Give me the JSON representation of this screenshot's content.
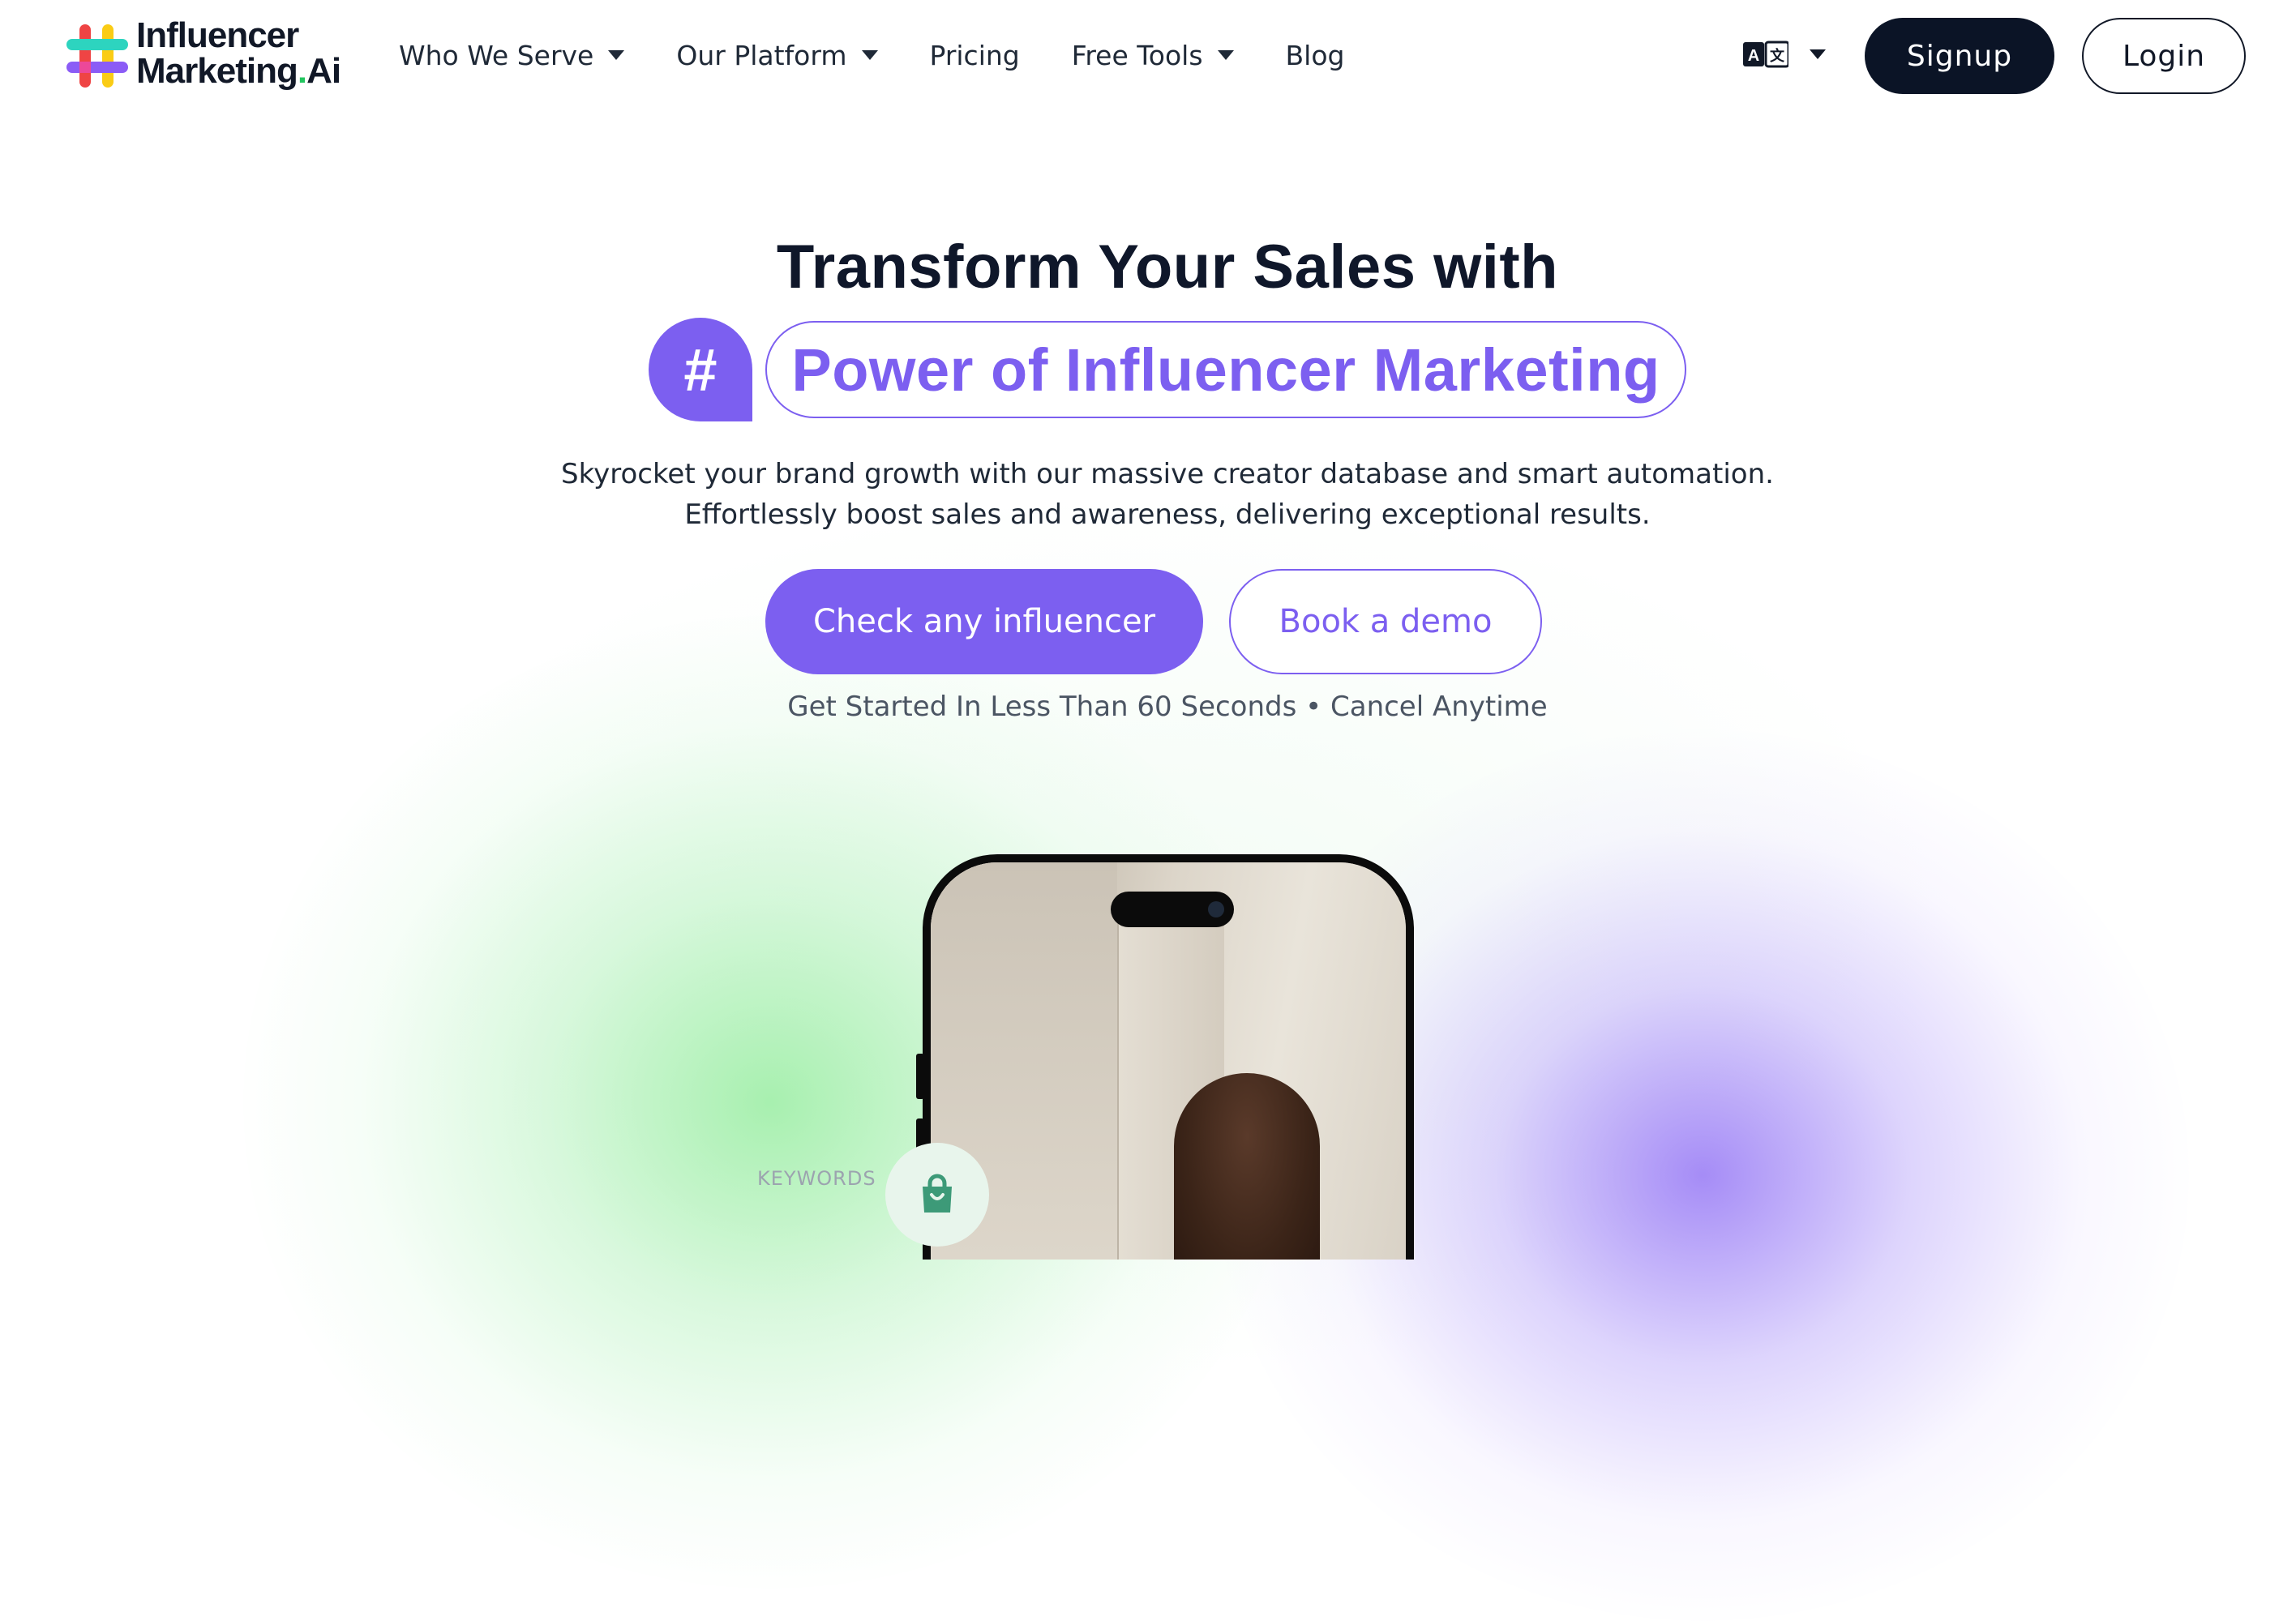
{
  "brand": {
    "logo_line1": "Influencer",
    "logo_line2_main": "Marketing",
    "logo_line2_dot": ".",
    "logo_line2_ai": "Ai",
    "colors": {
      "purple": "#7c5ff0",
      "navy": "#0b1426",
      "green": "#22c55e"
    }
  },
  "nav": {
    "items": [
      {
        "label": "Who We Serve",
        "has_dropdown": true
      },
      {
        "label": "Our Platform",
        "has_dropdown": true
      },
      {
        "label": "Pricing",
        "has_dropdown": false
      },
      {
        "label": "Free Tools",
        "has_dropdown": true
      },
      {
        "label": "Blog",
        "has_dropdown": false
      }
    ],
    "language_icon": "translate-icon",
    "signup_label": "Signup",
    "login_label": "Login"
  },
  "hero": {
    "title": "Transform Your Sales with",
    "badge_symbol": "#",
    "highlight": "Power of Influencer Marketing",
    "subtitle_line1": "Skyrocket your brand growth with our massive creator database and smart automation.",
    "subtitle_line2": "Effortlessly boost sales and awareness, delivering exceptional results.",
    "primary_cta": "Check any influencer",
    "secondary_cta": "Book a demo",
    "tagline": "Get Started In Less Than 60 Seconds • Cancel Anytime"
  },
  "preview": {
    "keywords_label": "KEYWORDS",
    "bag_icon": "shopping-bag-icon"
  }
}
